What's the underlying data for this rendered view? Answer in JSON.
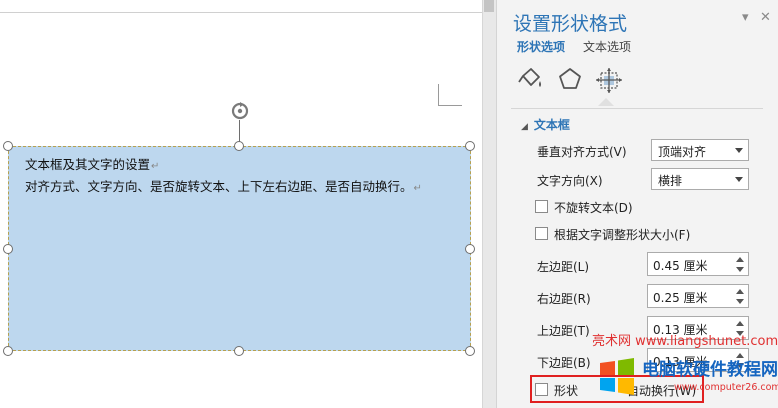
{
  "document": {
    "textbox": {
      "line1": "文本框及其文字的设置",
      "line2": "对齐方式、文字方向、是否旋转文本、上下左右边距、是否自动换行。",
      "paragraph_mark": "↵"
    }
  },
  "pane": {
    "title": "设置形状格式",
    "pin_glyph": "▾",
    "close_glyph": "✕",
    "tabs": [
      {
        "label": "形状选项",
        "active": true
      },
      {
        "label": "文本选项",
        "active": false
      }
    ],
    "icons": [
      "fill-line-icon",
      "effects-pentagon-icon",
      "layout-properties-icon"
    ],
    "section": {
      "collapse_glyph": "◢",
      "title": "文本框",
      "vertical_align": {
        "label": "垂直对齐方式(V)",
        "value": "顶端对齐"
      },
      "text_direction": {
        "label": "文字方向(X)",
        "value": "横排"
      },
      "no_rotate": {
        "label": "不旋转文本(D)",
        "checked": false
      },
      "resize_shape": {
        "label": "根据文字调整形状大小(F)",
        "checked": false
      },
      "left_margin": {
        "label": "左边距(L)",
        "value": "0.45 厘米"
      },
      "right_margin": {
        "label": "右边距(R)",
        "value": "0.25 厘米"
      },
      "top_margin": {
        "label": "上边距(T)",
        "value": "0.13 厘米"
      },
      "bottom_margin": {
        "label": "下边距(B)",
        "value": "0.13 厘米"
      },
      "wrap_text": {
        "label_prefix": "形状",
        "label_suffix": "自动换行(W)",
        "checked": false
      }
    }
  },
  "watermark": {
    "brand": "亮术网 www.liangshunet.com",
    "name": "电脑软硬件教程网",
    "url": "www.computer26.com"
  },
  "colors": {
    "accent": "#2e75b6",
    "textbox_fill": "#bdd7ee",
    "highlight": "#e02020"
  }
}
